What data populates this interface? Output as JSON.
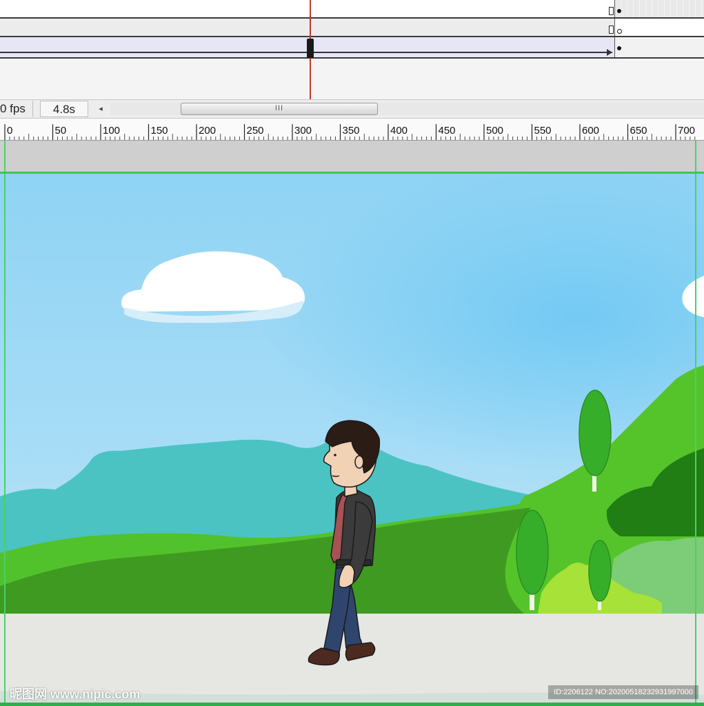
{
  "timeline": {
    "frame_rate": "0 fps",
    "elapsed_time": "4.8s",
    "scrollbar_grip": "III",
    "scroll_left_arrow": "◂"
  },
  "ruler": {
    "labels": [
      "0",
      "50",
      "100",
      "150",
      "200",
      "250",
      "300",
      "350",
      "400",
      "450",
      "500",
      "550",
      "600",
      "650",
      "700"
    ]
  },
  "stage": {
    "colors": {
      "sky_top": "#8fd3f4",
      "sky_bottom": "#c7e9f8",
      "mountain": "#4bc3c3",
      "grass_light": "#52c22c",
      "grass_dark": "#3f9a22",
      "ground": "#e6e7e3",
      "guide": "#3cc45c"
    },
    "character": {
      "shirt": "#3b3b3b",
      "tie": "#a85256",
      "pants": "#2f456e"
    }
  },
  "watermark": {
    "site": "昵图网 www.nipic.com",
    "id_text": "ID:2206122 NO:20200518232931997000"
  }
}
